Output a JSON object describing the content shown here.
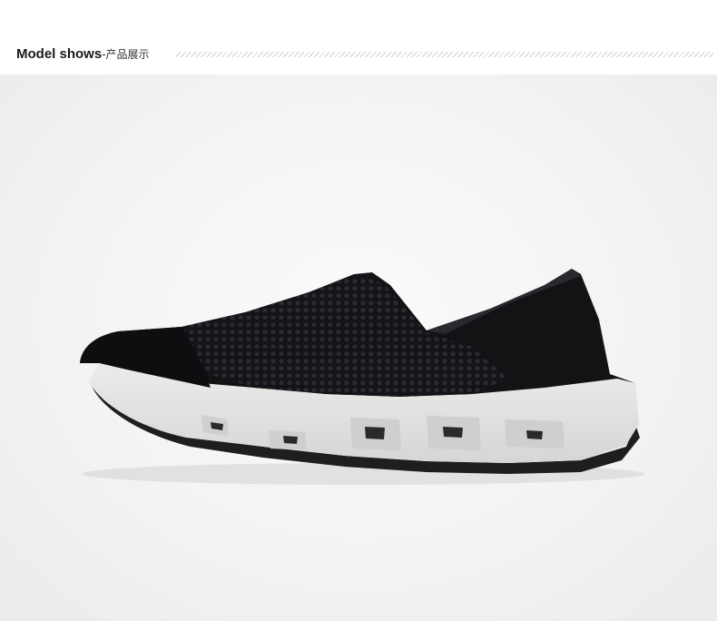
{
  "header": {
    "title_main": "Model shows",
    "title_sub": "-产品展示"
  },
  "product_image": {
    "subject": "shoe-icon",
    "colors": {
      "upper": "#111114",
      "sole": "#e2e2e0",
      "outsole": "#1e1e1e"
    }
  }
}
